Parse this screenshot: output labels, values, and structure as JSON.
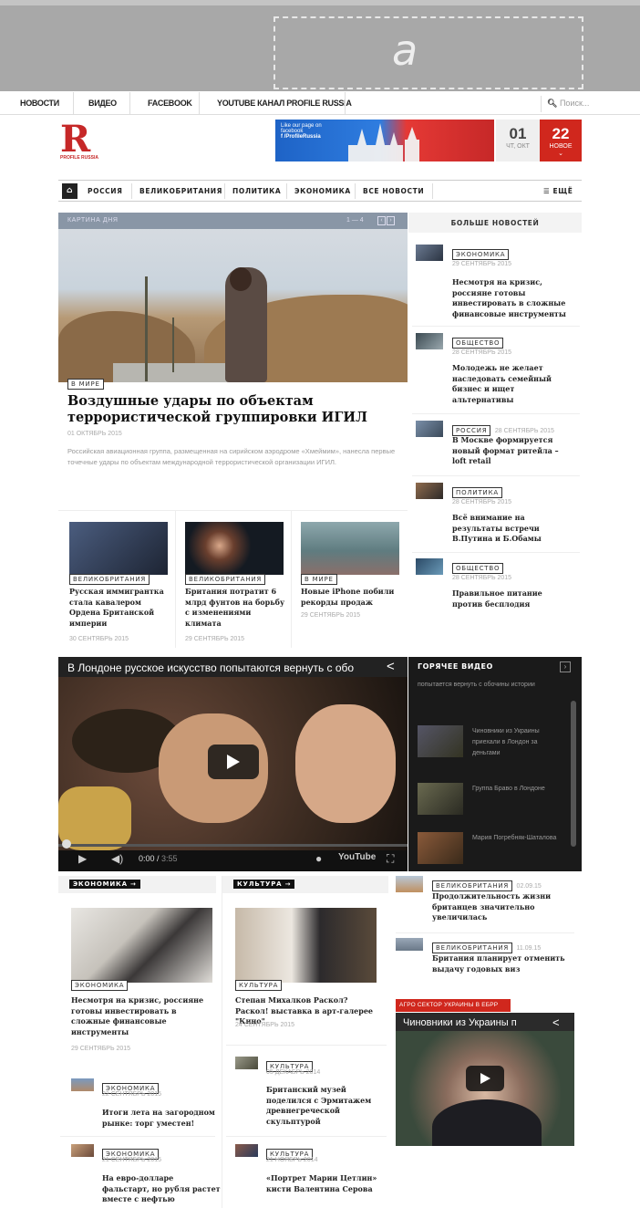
{
  "ad": {
    "letter": "a"
  },
  "top_nav": {
    "items": [
      "НОВОСТИ",
      "ВИДЕО",
      "FACEBOOK",
      "YOUTUBE КАНАЛ PROFILE RUSSIA"
    ],
    "search_placeholder": "Поиск..."
  },
  "logo": {
    "letter": "R",
    "text": "PROFILE RUSSIA"
  },
  "banner": {
    "line1": "Like our page on facebook",
    "line2": "f /ProfileRussia"
  },
  "date_box": {
    "day": "01",
    "label": "ЧТ, ОКТ"
  },
  "new_box": {
    "count": "22",
    "label": "НОВОЕ",
    "chevron": "⌄"
  },
  "main_nav": {
    "home_icon": "home-icon",
    "items": [
      "РОССИЯ",
      "ВЕЛИКОБРИТАНИЯ",
      "ПОЛИТИКА",
      "ЭКОНОМИКА",
      "ВСЕ НОВОСТИ"
    ],
    "more": "☰ ЕЩЁ"
  },
  "hero": {
    "section_label": "КАРТИНА ДНЯ",
    "pager": "1 — 4",
    "tag": "В МИРЕ",
    "title": "Воздушные удары по объектам террористической группировки ИГИЛ",
    "date": "01 ОКТЯБРЬ 2015",
    "excerpt": "Российская авиационная группа, размещенная на сирийском аэродроме «Хмеймим», нанесла первые точечные удары по объектам международной террористической организации ИГИЛ."
  },
  "cards": [
    {
      "tag": "ВЕЛИКОБРИТАНИЯ",
      "title": "Русская иммигрантка стала кавалером Ордена Британской империи",
      "date": "30 СЕНТЯБРЬ 2015",
      "img_color": "#3a4a66"
    },
    {
      "tag": "ВЕЛИКОБРИТАНИЯ",
      "title": "Британия потратит 6 млрд фунтов на борьбу с изменениями климата",
      "date": "29 СЕНТЯБРЬ 2015",
      "img_color": "#1e2a38"
    },
    {
      "tag": "В МИРЕ",
      "title": "Новые iPhone побили рекорды продаж",
      "date": "29 СЕНТЯБРЬ 2015",
      "img_color": "#6f8c8e"
    }
  ],
  "more_news": {
    "heading": "БОЛЬШЕ НОВОСТЕЙ",
    "items": [
      {
        "tag": "ЭКОНОМИКА",
        "date": "29 СЕНТЯБРЬ 2015",
        "title": "Несмотря на кризис, россияне готовы инвестировать в сложные финансовые инструменты"
      },
      {
        "tag": "ОБЩЕСТВО",
        "date": "28 СЕНТЯБРЬ 2015",
        "title": "Молодежь не желает наследовать семейный бизнес и ищет альтернативы"
      },
      {
        "tag": "РОССИЯ",
        "date": "28 СЕНТЯБРЬ 2015",
        "title": "В Москве формируется новый формат ритейла – loft retail"
      },
      {
        "tag": "ПОЛИТИКА",
        "date": "28 СЕНТЯБРЬ 2015",
        "title": "Всё внимание на результаты встречи В.Путина и Б.Обамы"
      },
      {
        "tag": "ОБЩЕСТВО",
        "date": "28 СЕНТЯБРЬ 2015",
        "title": "Правильное питание против бесплодия"
      }
    ]
  },
  "video": {
    "title": "В Лондоне русское искусство попытаются вернуть с обо",
    "time_current": "0:00",
    "time_total": "3:55",
    "youtube": "YouTube"
  },
  "hot_video": {
    "heading": "ГОРЯЧЕЕ ВИДЕО",
    "partial": "попытается вернуть с обочины истории",
    "items": [
      "Чиновники из Украины приехали в Лондон за деньгами",
      "Группа Браво в Лондоне",
      "Мария Погребняк-Шаталова"
    ]
  },
  "economy": {
    "heading": "ЭКОНОМИКА →",
    "main": {
      "tag": "ЭКОНОМИКА",
      "title": "Несмотря на кризис, россияне готовы инвестировать в сложные финансовые инструменты",
      "date": "29 СЕНТЯБРЬ 2015"
    },
    "list": [
      {
        "tag": "ЭКОНОМИКА",
        "date": "22 СЕНТЯБРЬ 2015",
        "title": "Итоги лета на загородном рынке: торг уместен!"
      },
      {
        "tag": "ЭКОНОМИКА",
        "date": "21 СЕНТЯБРЬ 2015",
        "title": "На евро-долларе фальстарт, но рубля растет вместе с нефтью"
      }
    ]
  },
  "culture": {
    "heading": "КУЛЬТУРА →",
    "main": {
      "tag": "КУЛЬТУРА",
      "title": "Степан Михалков Раскол? Раскол! выставка в арт-галерее \"Кино\"",
      "date": "24 СЕНТЯБРЬ 2015"
    },
    "list": [
      {
        "tag": "КУЛЬТУРА",
        "date": "05 ДЕКАБРЬ 2014",
        "title": "Британский музей поделился с Эрмитажем древнегреческой скульптурой"
      },
      {
        "tag": "КУЛЬТУРА",
        "date": "21 НОЯБРЬ 2014",
        "title": "«Портрет Марии Цетлин» кисти Валентина Серова"
      }
    ]
  },
  "uk_list": [
    {
      "tag": "ВЕЛИКОБРИТАНИЯ",
      "date": "02.09.15",
      "title": "Продолжительность жизни британцев значительно увеличилась"
    },
    {
      "tag": "ВЕЛИКОБРИТАНИЯ",
      "date": "11.09.15",
      "title": "Британия планирует отменить выдачу годовых виз"
    }
  ],
  "side_video": {
    "label": "АГРО СЕКТОР УКРАИНЫ В ЕБРР",
    "title": "Чиновники из Украины п"
  }
}
